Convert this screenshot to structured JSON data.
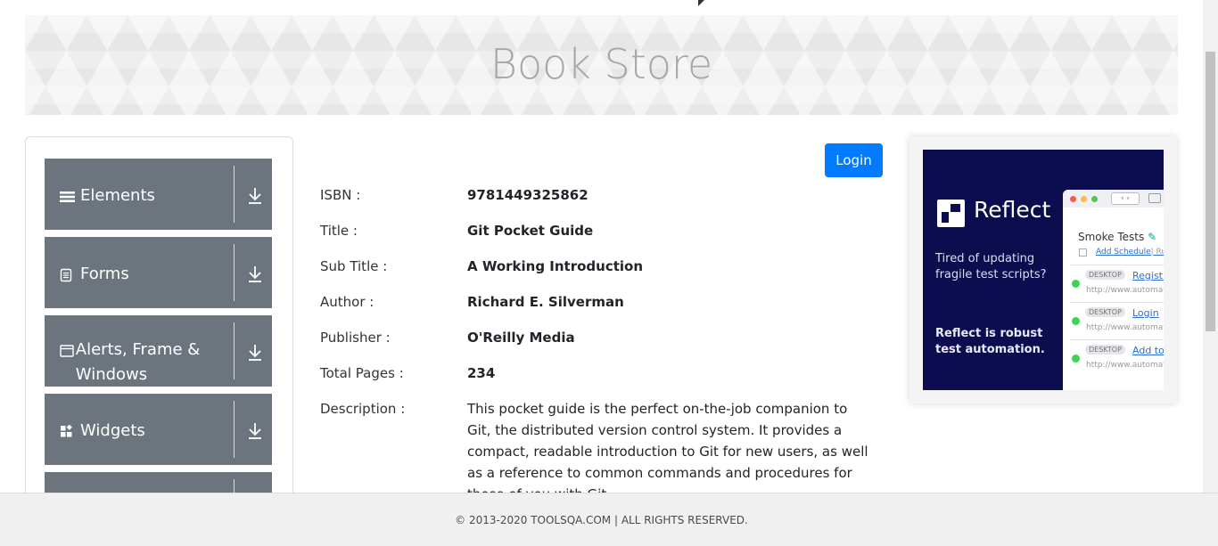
{
  "header": {
    "title": "Book Store"
  },
  "nav": [
    {
      "label": "Elements",
      "icon": "menu-icon"
    },
    {
      "label": "Forms",
      "icon": "document-icon"
    },
    {
      "label": "Alerts, Frame & Windows",
      "icon": "window-icon"
    },
    {
      "label": "Widgets",
      "icon": "widgets-icon"
    },
    {
      "label": "",
      "icon": ""
    }
  ],
  "login": {
    "label": "Login"
  },
  "book": {
    "isbn_label": "ISBN :",
    "isbn": "9781449325862",
    "title_label": "Title :",
    "title": "Git Pocket Guide",
    "subtitle_label": "Sub Title :",
    "subtitle": "A Working Introduction",
    "author_label": "Author :",
    "author": "Richard E. Silverman",
    "publisher_label": "Publisher :",
    "publisher": "O'Reilly Media",
    "pages_label": "Total Pages :",
    "pages": "234",
    "description_label": "Description :",
    "description": "This pocket guide is the perfect on-the-job companion to Git, the distributed version control system. It provides a compact, readable introduction to Git for new users, as well as a reference to common commands and procedures for those of you with Git"
  },
  "ad": {
    "brand": "Reflect",
    "tagline": "Tired of updating fragile test scripts?",
    "tagline2": "Reflect is robust test automation.",
    "panel_title": "Smoke Tests",
    "schedule_link": "Add Schedule",
    "schedule_extra": "| Ru",
    "items": [
      {
        "badge": "DESKTOP",
        "link": "Registr",
        "url": "http://www.automat"
      },
      {
        "badge": "DESKTOP",
        "link": "Login",
        "url": "http://www.automat"
      },
      {
        "badge": "DESKTOP",
        "link": "Add to",
        "url": "http://www.automat"
      }
    ]
  },
  "footer": {
    "text": "© 2013-2020 TOOLSQA.COM | ALL RIGHTS RESERVED."
  },
  "colors": {
    "accent": "#007bff",
    "nav_bg": "#6c757d",
    "ad_bg": "#0b0d4f"
  }
}
